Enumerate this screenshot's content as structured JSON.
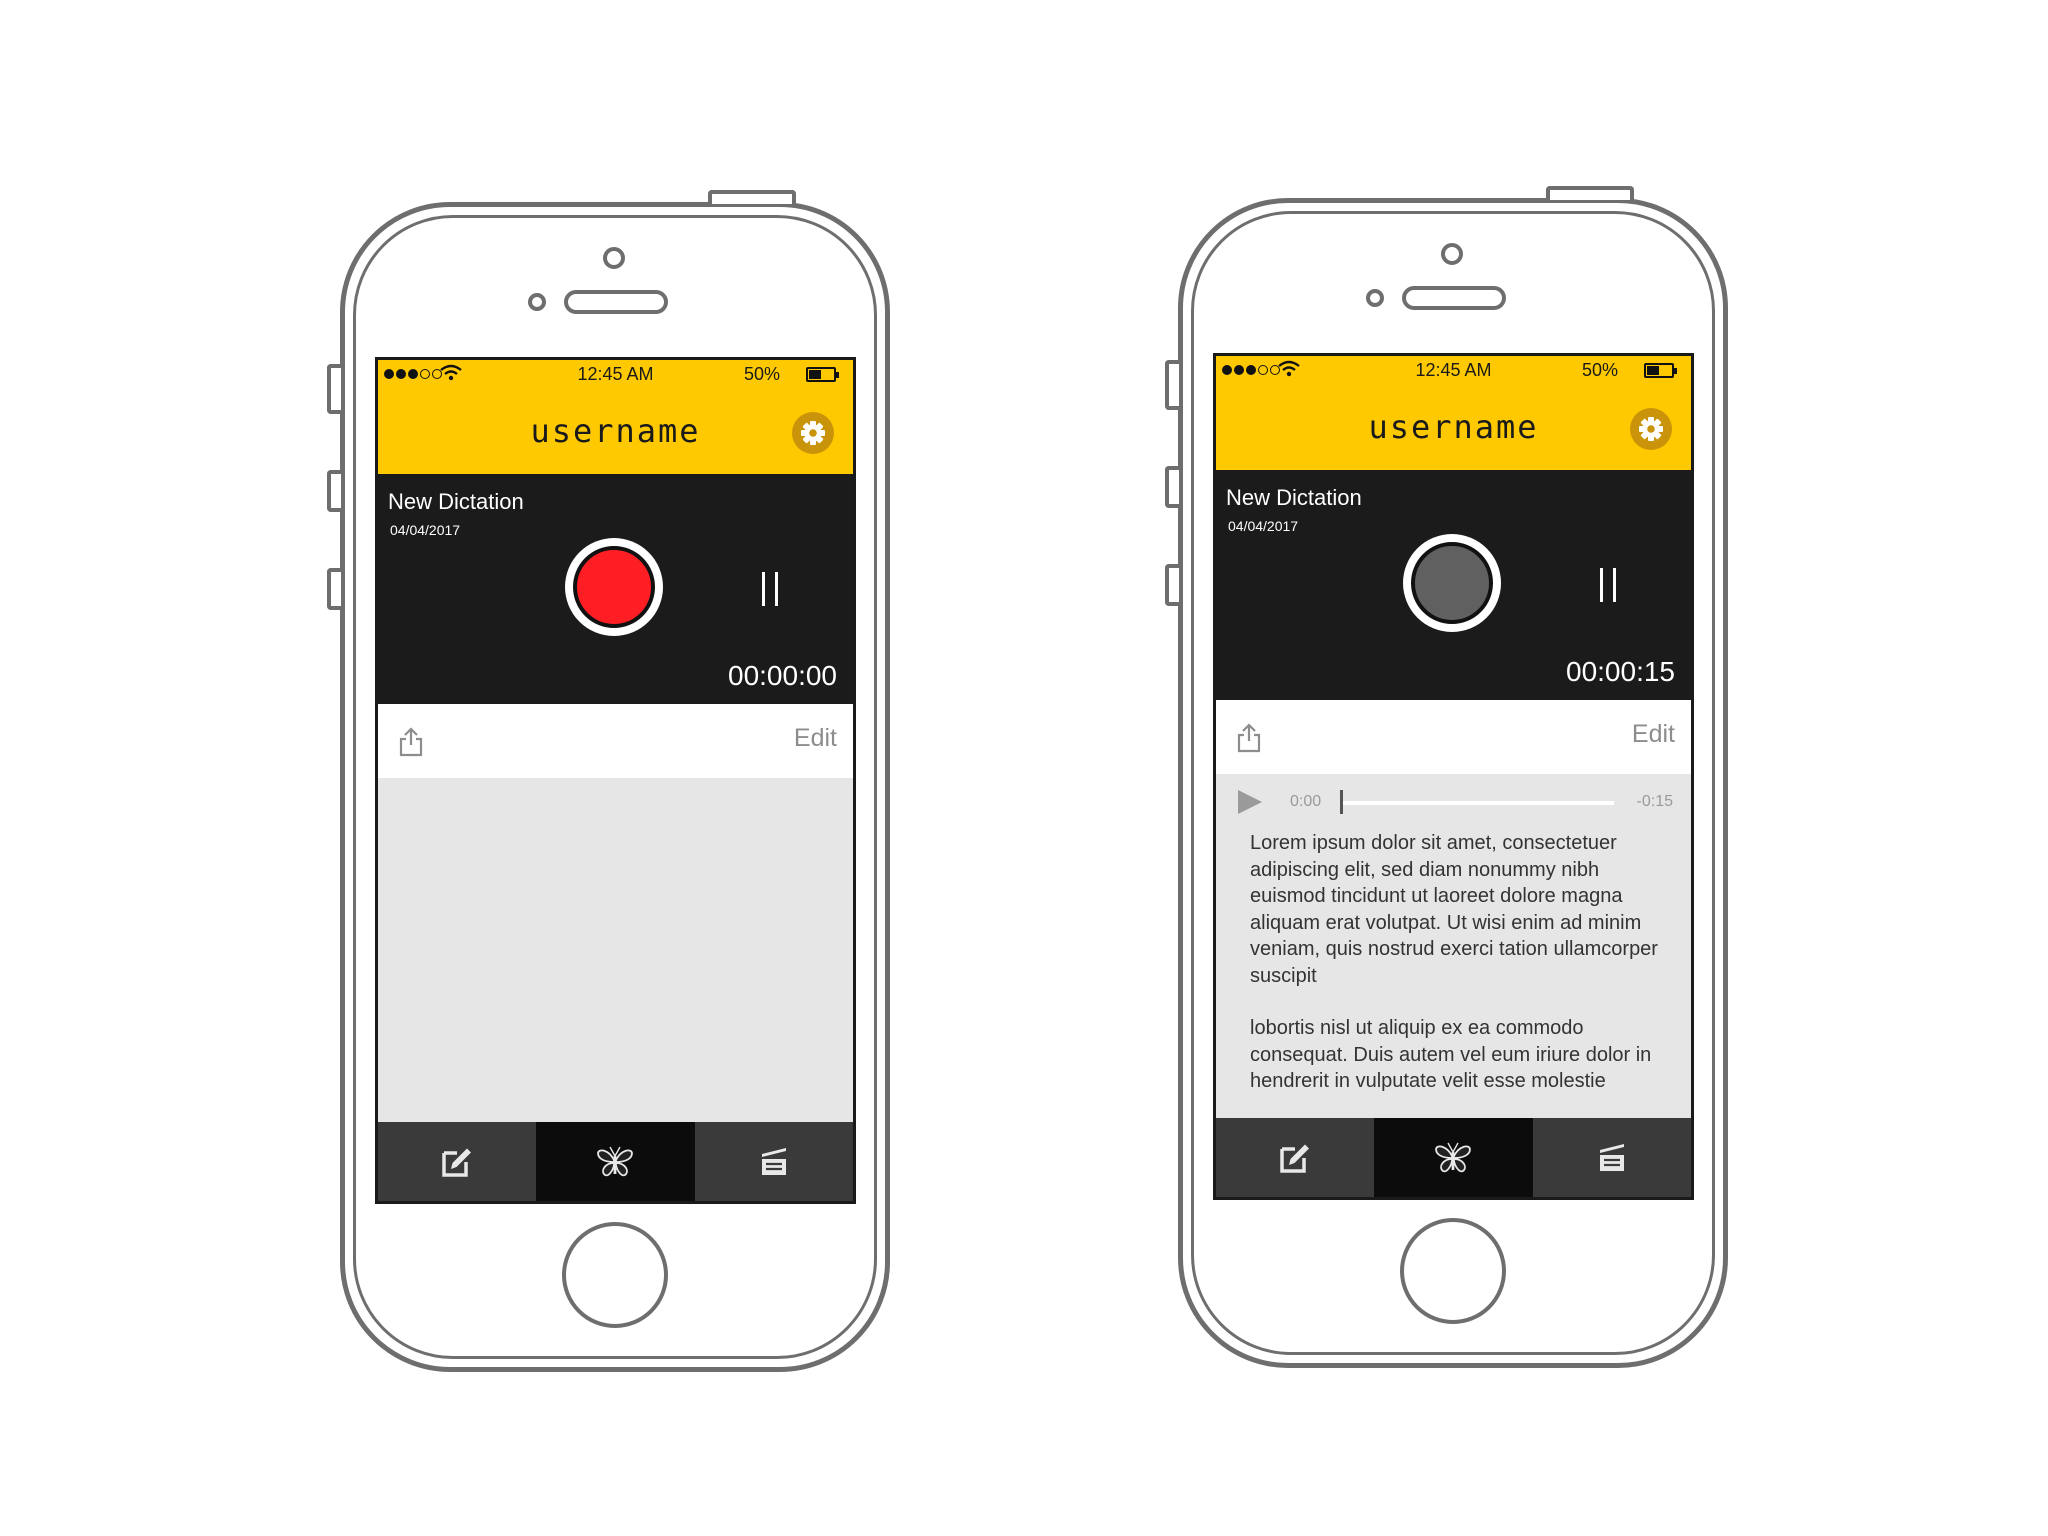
{
  "colors": {
    "header_bg": "#fec900",
    "dark_panel": "#1b1b1b",
    "record_active": "#ff1e24",
    "record_idle": "#606060",
    "settings_bg": "#c9940a",
    "tab_bar": "#3a3a3a",
    "tab_active": "#0c0c0c"
  },
  "phones": [
    {
      "status": {
        "time": "12:45 AM",
        "battery": "50%"
      },
      "header": {
        "username": "username",
        "settings_icon": "gear-icon"
      },
      "dictation": {
        "title": "New Dictation",
        "date": "04/04/2017",
        "timer": "00:00:00",
        "record_state": "recording"
      },
      "actions": {
        "share_icon": "share-icon",
        "edit_label": "Edit"
      },
      "tabs": [
        {
          "icon": "compose-icon",
          "active": false
        },
        {
          "icon": "butterfly-icon",
          "active": true
        },
        {
          "icon": "documents-icon",
          "active": false
        }
      ]
    },
    {
      "status": {
        "time": "12:45 AM",
        "battery": "50%"
      },
      "header": {
        "username": "username",
        "settings_icon": "gear-icon"
      },
      "dictation": {
        "title": "New Dictation",
        "date": "04/04/2017",
        "timer": "00:00:15",
        "record_state": "stopped"
      },
      "actions": {
        "share_icon": "share-icon",
        "edit_label": "Edit"
      },
      "player": {
        "elapsed": "0:00",
        "remaining": "-0:15",
        "progress": 0
      },
      "transcript": [
        "Lorem ipsum dolor sit amet, consectetuer adipiscing elit, sed diam nonummy nibh euismod tincidunt ut laoreet dolore magna aliquam erat volutpat. Ut wisi enim ad minim veniam, quis nostrud exerci tation ullamcorper suscipit",
        "lobortis nisl ut aliquip ex ea commodo consequat. Duis autem vel eum iriure dolor in hendrerit in vulputate velit esse molestie"
      ],
      "tabs": [
        {
          "icon": "compose-icon",
          "active": false
        },
        {
          "icon": "butterfly-icon",
          "active": true
        },
        {
          "icon": "documents-icon",
          "active": false
        }
      ]
    }
  ]
}
